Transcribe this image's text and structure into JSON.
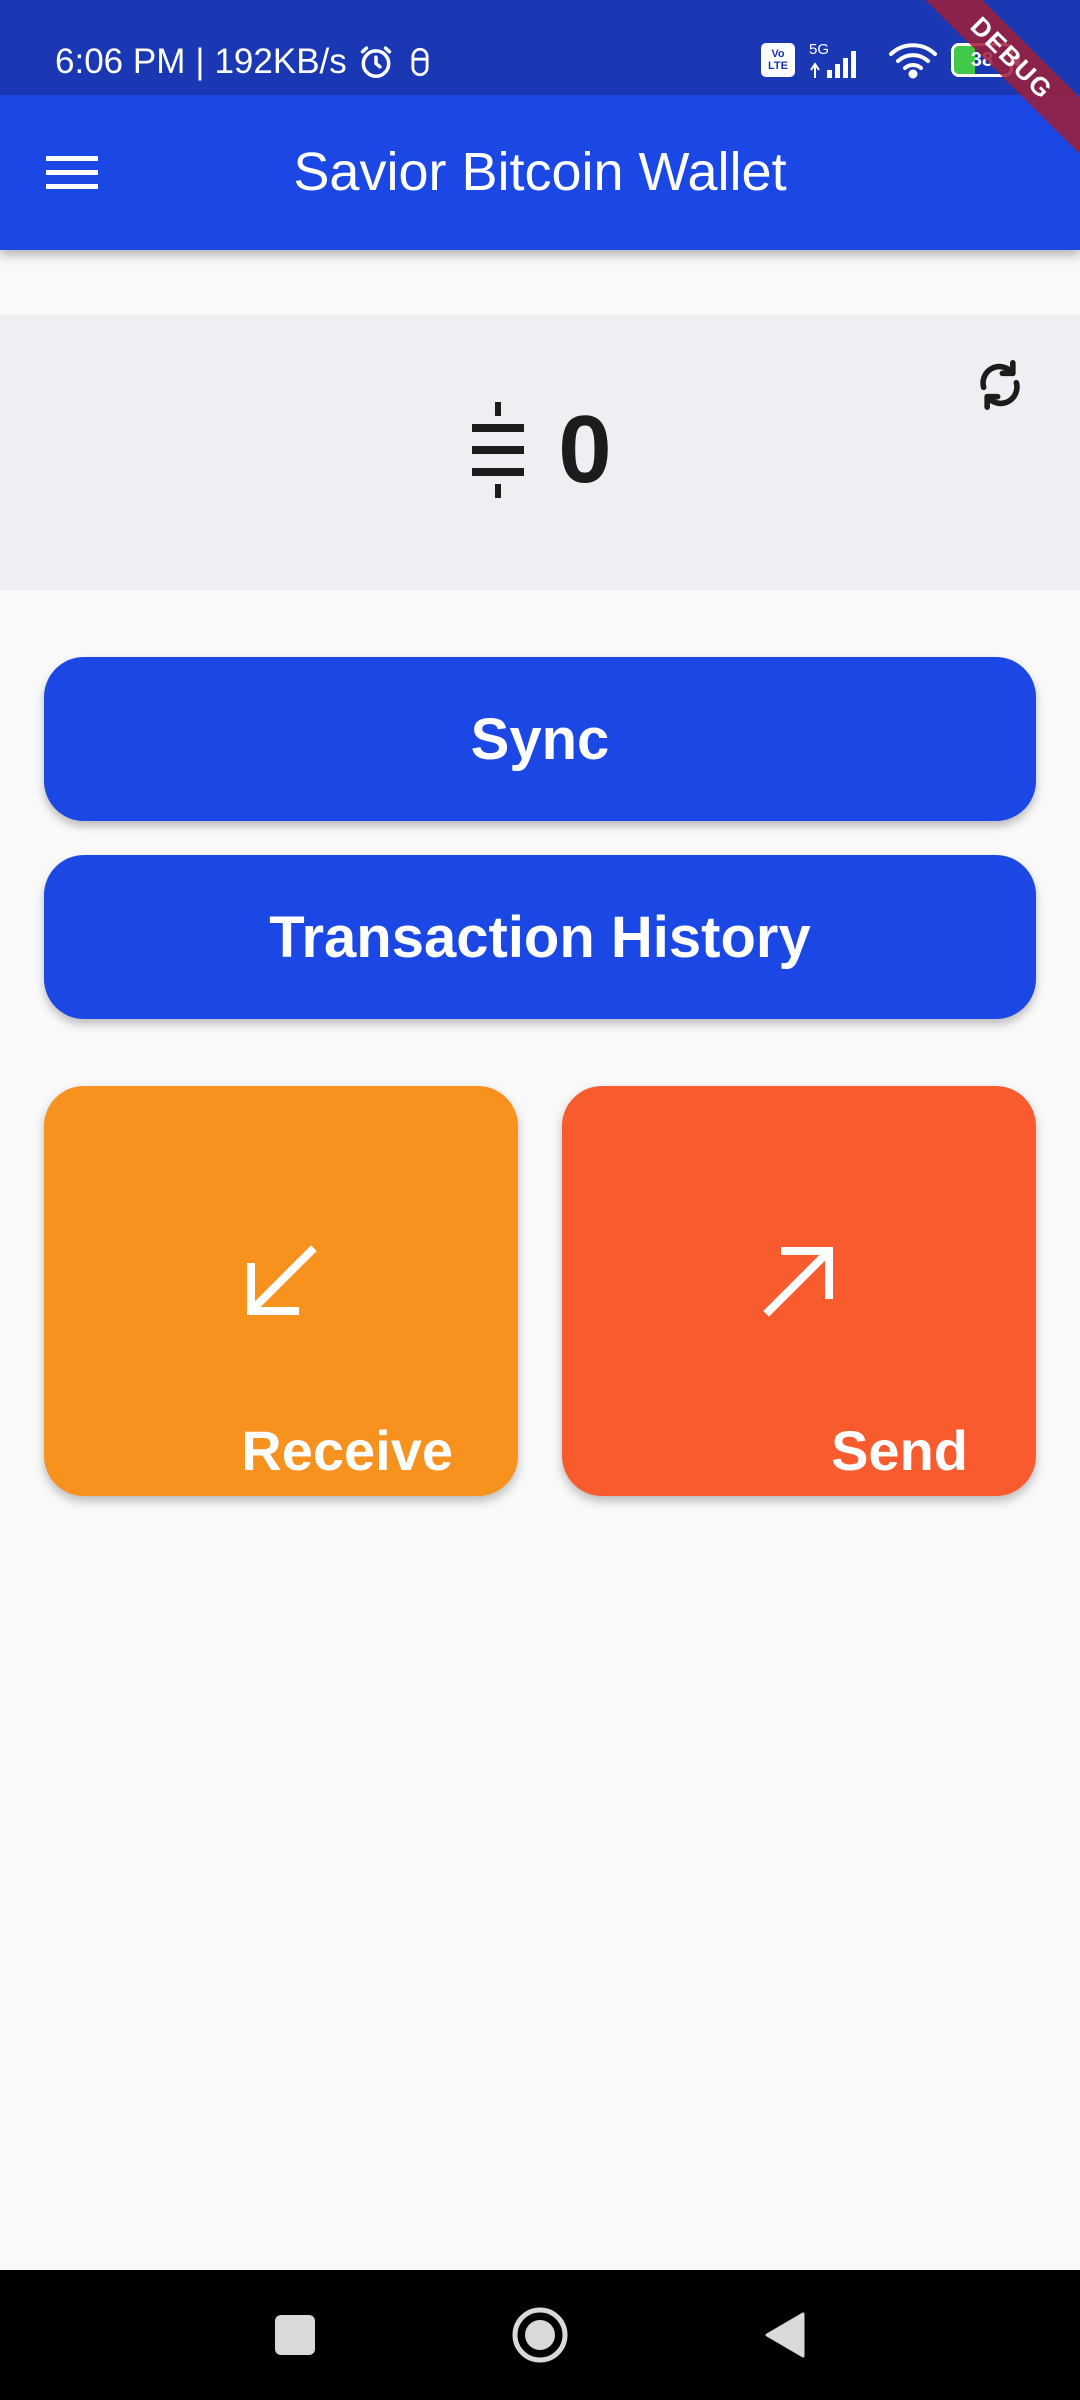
{
  "status_bar": {
    "time": "6:06 PM",
    "separator": "|",
    "net_speed": "192KB/s",
    "alarm_icon": "alarm-clock-icon",
    "notification_icon": "accessibility-icon",
    "volte_label_top": "Vo",
    "volte_label_bottom": "LTE",
    "network_type": "5G",
    "signal_icon": "cellular-signal-icon",
    "wifi_icon": "wifi-icon",
    "battery_level": "38",
    "battery_color": "#43c94a"
  },
  "debug_banner": {
    "label": "DEBUG"
  },
  "app_bar": {
    "title": "Savior Bitcoin Wallet",
    "menu_icon": "hamburger-menu-icon",
    "background_color": "#1b48e4"
  },
  "balance": {
    "currency_icon": "satoshi-symbol-icon",
    "amount": "0",
    "refresh_icon": "refresh-icon"
  },
  "actions": {
    "sync_label": "Sync",
    "history_label": "Transaction History",
    "receive_label": "Receive",
    "receive_icon": "arrow-down-left-icon",
    "receive_color": "#f7921e",
    "send_label": "Send",
    "send_icon": "arrow-up-right-icon",
    "send_color": "#f85c2e"
  },
  "nav_bar": {
    "recents_icon": "square-recents-icon",
    "home_icon": "circle-home-icon",
    "back_icon": "triangle-back-icon"
  }
}
